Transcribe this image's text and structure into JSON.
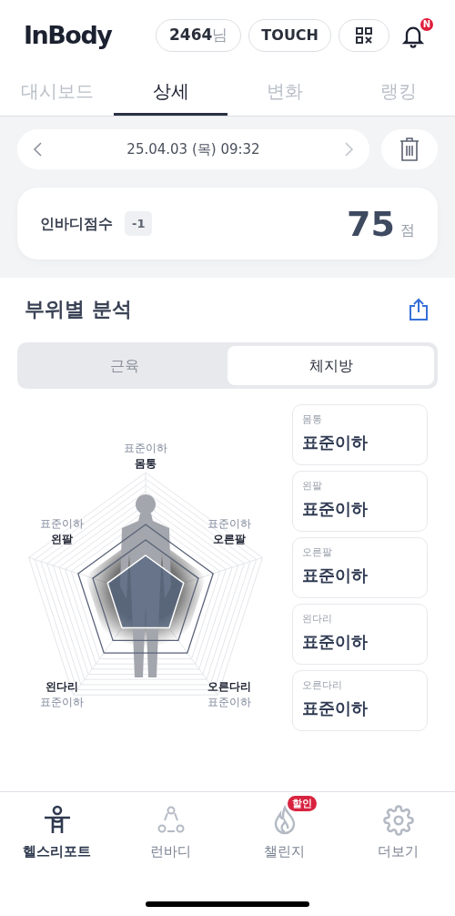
{
  "header": {
    "logo": "InBody",
    "user_number": "2464",
    "user_suffix": "님",
    "touch_button": "TOUCH",
    "notification_badge": "N"
  },
  "tabs": [
    {
      "label": "대시보드",
      "selected": false
    },
    {
      "label": "상세",
      "selected": true
    },
    {
      "label": "변화",
      "selected": false
    },
    {
      "label": "랭킹",
      "selected": false
    }
  ],
  "date_nav": {
    "date": "25.04.03 (목) 09:32"
  },
  "score": {
    "label": "인바디점수",
    "change": "-1",
    "value": "75",
    "unit": "점"
  },
  "section": {
    "title": "부위별 분석",
    "segments": [
      {
        "label": "근육",
        "selected": false
      },
      {
        "label": "체지방",
        "selected": true
      }
    ]
  },
  "radar_labels": [
    {
      "part": "몸통",
      "grade": "표준이하"
    },
    {
      "part": "왼팔",
      "grade": "표준이하"
    },
    {
      "part": "오른팔",
      "grade": "표준이하"
    },
    {
      "part": "왼다리",
      "grade": "표준이하"
    },
    {
      "part": "오른다리",
      "grade": "표준이하"
    }
  ],
  "cards": [
    {
      "part": "몸통",
      "grade": "표준이하"
    },
    {
      "part": "왼팔",
      "grade": "표준이하"
    },
    {
      "part": "오른팔",
      "grade": "표준이하"
    },
    {
      "part": "왼다리",
      "grade": "표준이하"
    },
    {
      "part": "오른다리",
      "grade": "표준이하"
    }
  ],
  "bottom_nav": [
    {
      "kind": "report",
      "label": "헬스리포트",
      "selected": true
    },
    {
      "kind": "run",
      "label": "런바디",
      "selected": false
    },
    {
      "kind": "challenge",
      "label": "챌린지",
      "selected": false,
      "badge": "할인"
    },
    {
      "kind": "more",
      "label": "더보기",
      "selected": false
    }
  ]
}
